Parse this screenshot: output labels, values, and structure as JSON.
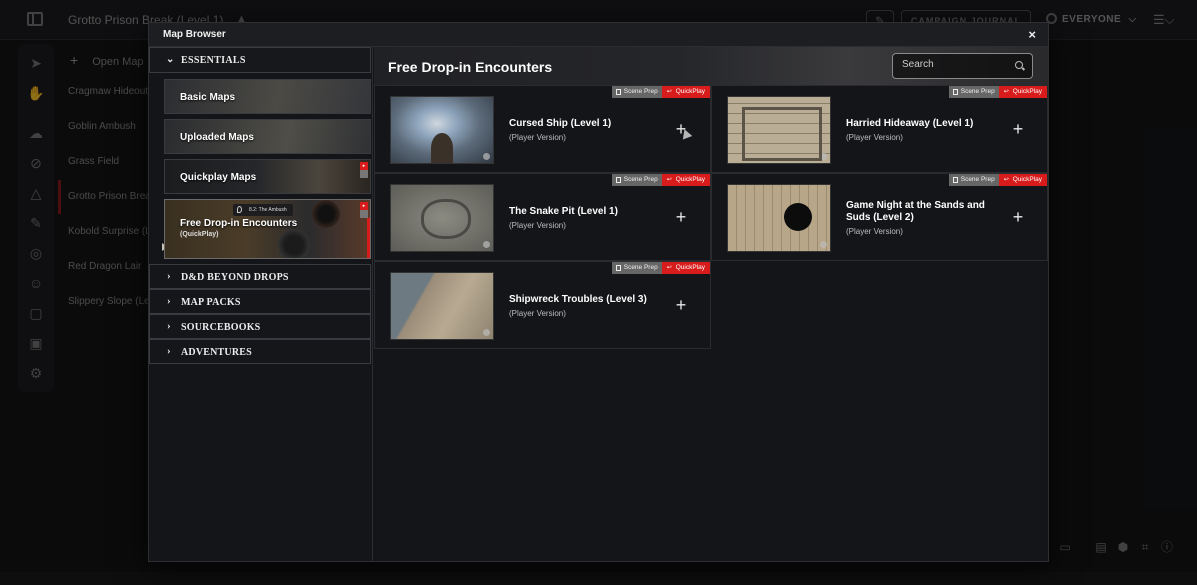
{
  "topbar": {
    "campaign_title": "Grotto Prison Break (Level 1)",
    "caret": "▲",
    "share_icon": "✎",
    "journal_label": "CAMPAIGN JOURNAL",
    "viewers_label": "EVERYONE",
    "viewers_caret": "⌵",
    "menu_icon": "☰⌵"
  },
  "toolrail": {
    "icons": [
      "cursor-icon",
      "hand-icon",
      "cloud-icon",
      "fog-icon",
      "shapes-icon",
      "ruler-icon",
      "target-icon",
      "user-circle-icon",
      "note-icon",
      "image-icon",
      "settings-pin-icon"
    ]
  },
  "scene_list": {
    "open_map_plus": "+",
    "open_map_label": "Open Map",
    "items": [
      "Cragmaw Hideout",
      "Goblin Ambush",
      "Grass Field",
      "Grotto Prison Break",
      "Kobold Surprise (L",
      "Red Dragon Lair",
      "Slippery Slope (Le"
    ]
  },
  "modal": {
    "title": "Map Browser",
    "close": "×"
  },
  "sidebar": {
    "essentials_label": "ESSENTIALS",
    "essentials_chevron": "⌄",
    "tiles": [
      {
        "label": "Basic Maps"
      },
      {
        "label": "Uploaded Maps"
      },
      {
        "label": "Quickplay Maps"
      },
      {
        "label": "Free Drop-in Encounters",
        "sub": "(QuickPlay)",
        "pin_label": "8.2: The Ambush"
      }
    ],
    "collapsed": [
      {
        "chevron": "›",
        "label": "D&D BEYOND DROPS"
      },
      {
        "chevron": "›",
        "label": "MAP PACKS"
      },
      {
        "chevron": "›",
        "label": "SOURCEBOOKS"
      },
      {
        "chevron": "›",
        "label": "ADVENTURES"
      }
    ]
  },
  "main": {
    "title": "Free Drop-in Encounters",
    "search_placeholder": "Search",
    "badge_prep": "Scene Prep",
    "badge_quick": "QuickPlay",
    "add_symbol": "+",
    "cards": [
      {
        "name": "Cursed Ship (Level 1)",
        "version": "(Player Version)"
      },
      {
        "name": "Harried Hideaway (Level 1)",
        "version": "(Player Version)"
      },
      {
        "name": "The Snake Pit (Level 1)",
        "version": "(Player Version)"
      },
      {
        "name": "Game Night at the Sands and Suds (Level 2)",
        "version": "(Player Version)"
      },
      {
        "name": "Shipwreck Troubles (Level 3)",
        "version": "(Player Version)"
      }
    ]
  },
  "colors": {
    "accent_red": "#d81b1b",
    "background": "#141518",
    "border": "#2a2b2f"
  }
}
